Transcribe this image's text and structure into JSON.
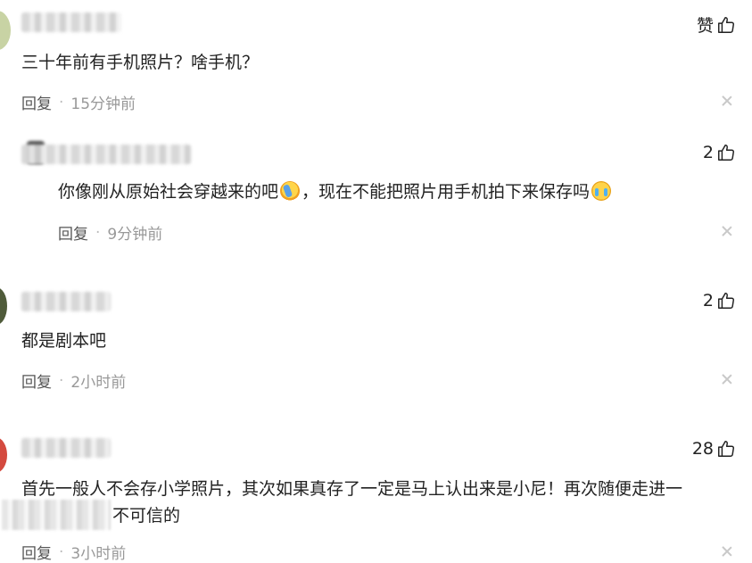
{
  "comments": [
    {
      "avatar_color": "#c8d3a4",
      "name_partial": "",
      "likes": "赞",
      "text": "三十年前有手机照片？啥手机？",
      "reply_label": "回复",
      "time": "15分钟前"
    },
    {
      "avatar_color": "#4a4a4a",
      "name_partial": "",
      "likes": "2",
      "text_before": "你像刚从原始社会穿越来的吧",
      "text_mid": "，现在不能把照片用手机拍下来保存吗",
      "reply_label": "回复",
      "time": "9分钟前"
    },
    {
      "avatar_color": "#4f5b3a",
      "name_partial": "",
      "likes": "2",
      "text": "都是剧本吧",
      "reply_label": "回复",
      "time": "2小时前"
    },
    {
      "avatar_color": "#d44a3f",
      "name_partial": "",
      "likes": "28",
      "text_line1": "首先一般人不会存小学照片，其次如果真存了一定是马上认出来是小尼！再次随便走进一",
      "text_line2": "不可信的",
      "reply_label": "回复",
      "time": "3小时前"
    }
  ],
  "icons": {
    "like": "thumbs-up-icon",
    "close": "close-icon",
    "emoji_clap": "party-emoji-icon",
    "emoji_cry": "crying-emoji-icon"
  }
}
